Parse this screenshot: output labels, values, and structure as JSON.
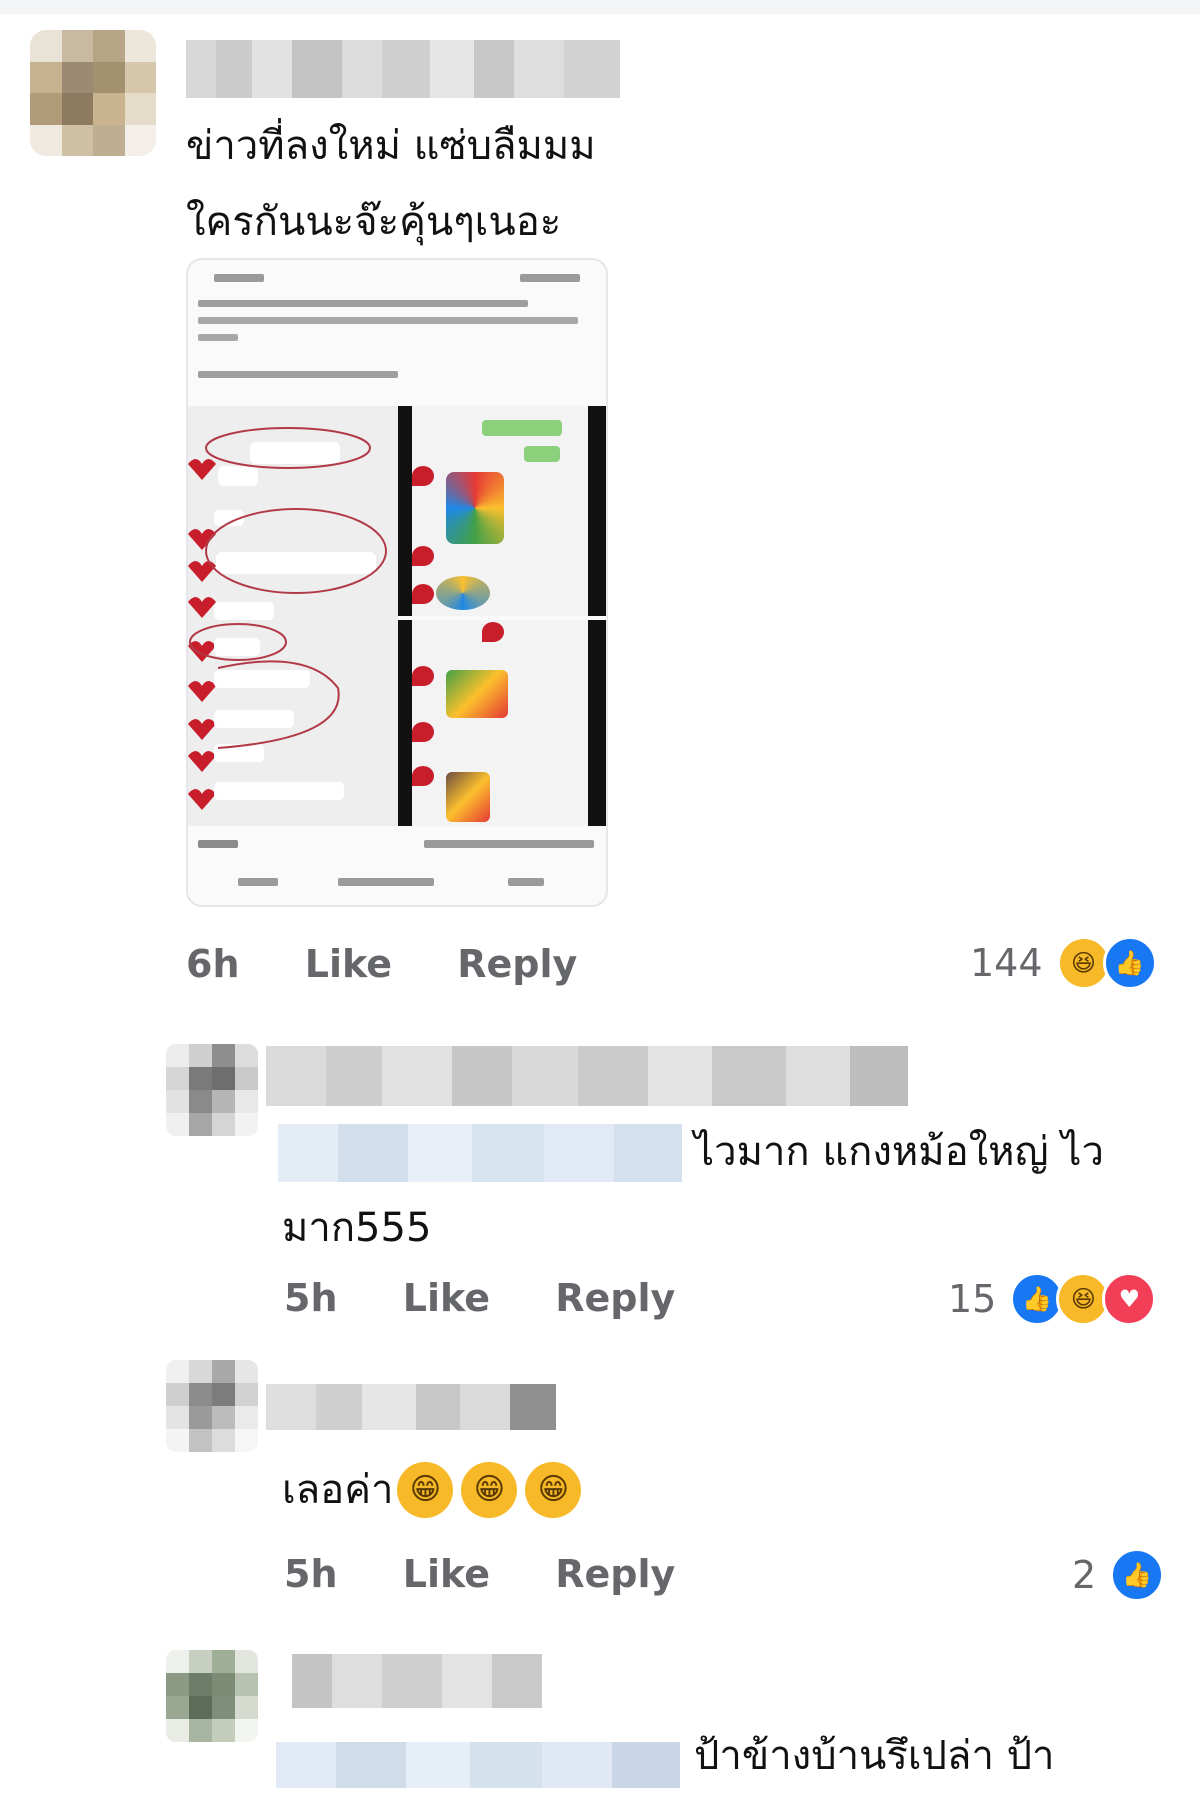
{
  "comments": [
    {
      "text_line1": "ข่าวที่ลงใหม่ แซ่บลืมมม",
      "text_line2": "ใครกันนะจ๊ะคุ้นๆเนอะ",
      "time": "6h",
      "like_label": "Like",
      "reply_label": "Reply",
      "reaction_count": "144",
      "reactions": [
        "haha",
        "like"
      ]
    },
    {
      "text_line1": "ไวมาก แกงหม้อใหญ่ ไว",
      "text_line2": "มาก555",
      "time": "5h",
      "like_label": "Like",
      "reply_label": "Reply",
      "reaction_count": "15",
      "reactions": [
        "like",
        "haha",
        "love"
      ]
    },
    {
      "text_line1": "เลอค่า",
      "time": "5h",
      "like_label": "Like",
      "reply_label": "Reply",
      "reaction_count": "2",
      "reactions": [
        "like"
      ]
    },
    {
      "text_line1": "ป้าข้างบ้านรึเปล่า ป้า"
    }
  ],
  "colors": {
    "like": "#1877f2",
    "haha": "#f7b928",
    "love": "#f33e58",
    "meta": "#65676b"
  },
  "icons": {
    "like": "thumbs-up-icon",
    "haha": "laughing-face-icon",
    "love": "heart-icon",
    "grin": "grinning-face-icon"
  }
}
